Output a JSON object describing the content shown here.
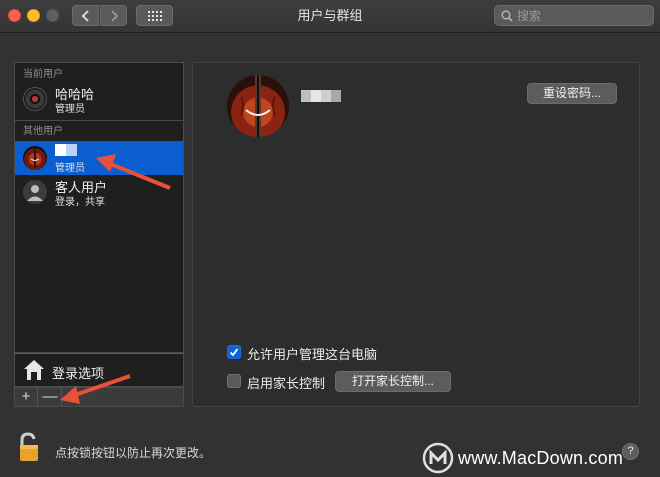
{
  "window": {
    "title": "用户与群组",
    "search_placeholder": "搜索"
  },
  "sidebar": {
    "current_users_header": "当前用户",
    "current_user": {
      "name": "哈哈哈",
      "role": "管理员"
    },
    "other_users_header": "其他用户",
    "other_users": [
      {
        "name": "",
        "role": "管理员",
        "selected": true
      },
      {
        "name": "客人用户",
        "role": "登录，共享",
        "selected": false
      }
    ],
    "login_options_label": "登录选项",
    "add_label": "+",
    "remove_label": "—"
  },
  "main": {
    "reset_password_label": "重设密码...",
    "allow_admin_label": "允许用户管理这台电脑",
    "allow_admin_checked": true,
    "parental_controls_label": "启用家长控制",
    "parental_controls_checked": false,
    "open_parental_controls_label": "打开家长控制..."
  },
  "footer": {
    "lock_text": "点按锁按钮以防止再次更改。",
    "help_label": "?",
    "watermark": "www.MacDown.com"
  },
  "colors": {
    "selection": "#0a5ecf",
    "checkbox_on": "#0a64d6",
    "arrow": "#e8503a",
    "lock": "#e6a22c"
  },
  "icons": {
    "lock": "lock-icon",
    "house": "house-icon",
    "search": "search-icon",
    "grid": "grid-icon"
  }
}
